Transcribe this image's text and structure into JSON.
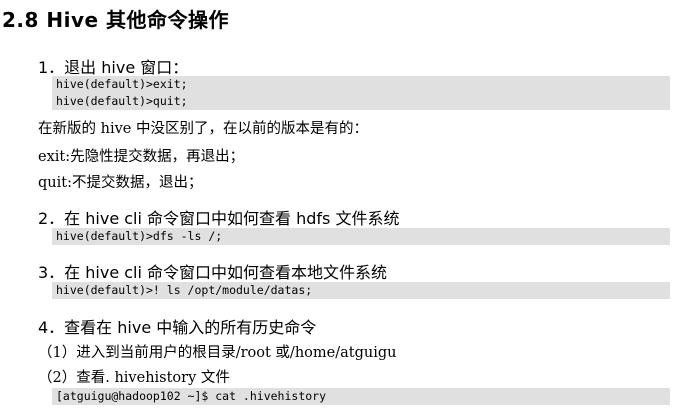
{
  "section_title": "2.8 Hive 其他命令操作",
  "steps": [
    {
      "heading": "1．退出 hive 窗口：",
      "code": [
        "hive(default)>exit;",
        "hive(default)>quit;"
      ],
      "paragraphs": [
        "在新版的 hive 中没区别了，在以前的版本是有的：",
        "exit:先隐性提交数据，再退出；",
        "quit:不提交数据，退出；"
      ]
    },
    {
      "heading": "2．在 hive cli 命令窗口中如何查看 hdfs 文件系统",
      "code": [
        "hive(default)>dfs -ls /;"
      ]
    },
    {
      "heading": "3．在 hive cli 命令窗口中如何查看本地文件系统",
      "code": [
        "hive(default)>! ls /opt/module/datas;"
      ]
    },
    {
      "heading": "4．查看在 hive 中输入的所有历史命令",
      "substeps": [
        "（1）进入到当前用户的根目录/root 或/home/atguigu",
        "（2）查看. hivehistory 文件"
      ],
      "code": [
        "[atguigu@hadoop102 ~]$ cat .hivehistory"
      ]
    }
  ]
}
